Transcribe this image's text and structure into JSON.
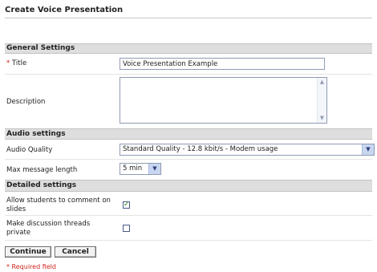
{
  "page": {
    "title": "Create Voice Presentation"
  },
  "general": {
    "heading": "General Settings",
    "title_asterisk": "*",
    "title_label": "Title",
    "title_value": "Voice Presentation Example",
    "description_label": "Description",
    "description_value": ""
  },
  "audio": {
    "heading": "Audio settings",
    "quality_label": "Audio Quality",
    "quality_value": "Standard Quality - 12.8 kbit/s - Modem usage",
    "max_length_label": "Max message length",
    "max_length_value": "5 min"
  },
  "detailed": {
    "heading": "Detailed settings",
    "allow_comment_label": "Allow students to comment on slides",
    "allow_comment_checked": true,
    "private_threads_label": "Make discussion threads private",
    "private_threads_checked": false
  },
  "buttons": {
    "continue": "Continue",
    "cancel": "Cancel"
  },
  "footer": {
    "required_note": "* Required field"
  },
  "icons": {
    "dropdown": "chevron-down-icon",
    "scroll_up": "scroll-up-icon",
    "scroll_down": "scroll-down-icon",
    "check": "checkmark-icon"
  },
  "colors": {
    "section_bg": "#dedede",
    "required": "#d0231d",
    "check": "#1d8a1d",
    "select_arrow_bg": "#c9d6f1"
  }
}
